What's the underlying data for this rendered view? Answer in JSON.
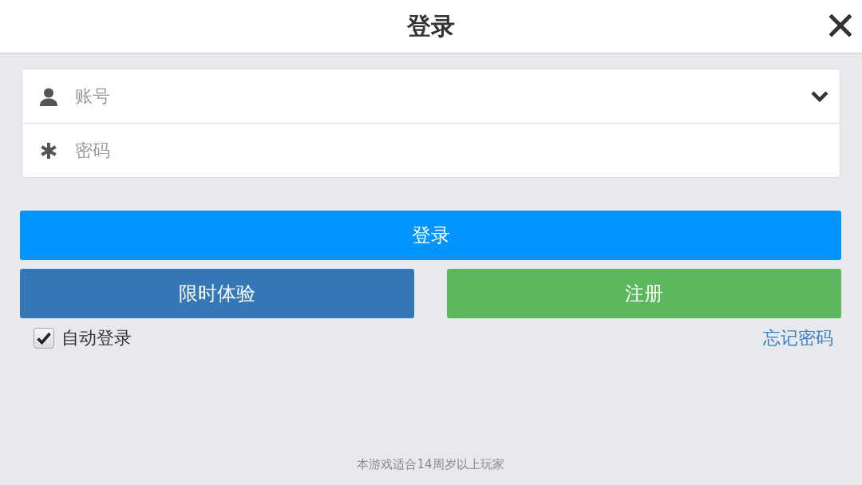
{
  "header": {
    "title": "登录"
  },
  "form": {
    "fields": [
      {
        "kind": "account",
        "placeholder": "账号",
        "dropdown": true
      },
      {
        "kind": "password",
        "placeholder": "密码",
        "dropdown": false
      }
    ]
  },
  "login_button": {
    "label": "登录"
  },
  "secondary_buttons": [
    {
      "kind": "trial",
      "label": "限时体验"
    },
    {
      "kind": "register",
      "label": "注册"
    }
  ],
  "auto_login": {
    "label": "自动登录",
    "checked": true
  },
  "forgot_password": {
    "label": "忘记密码"
  },
  "footer": {
    "notice": "本游戏适合14周岁以上玩家"
  }
}
